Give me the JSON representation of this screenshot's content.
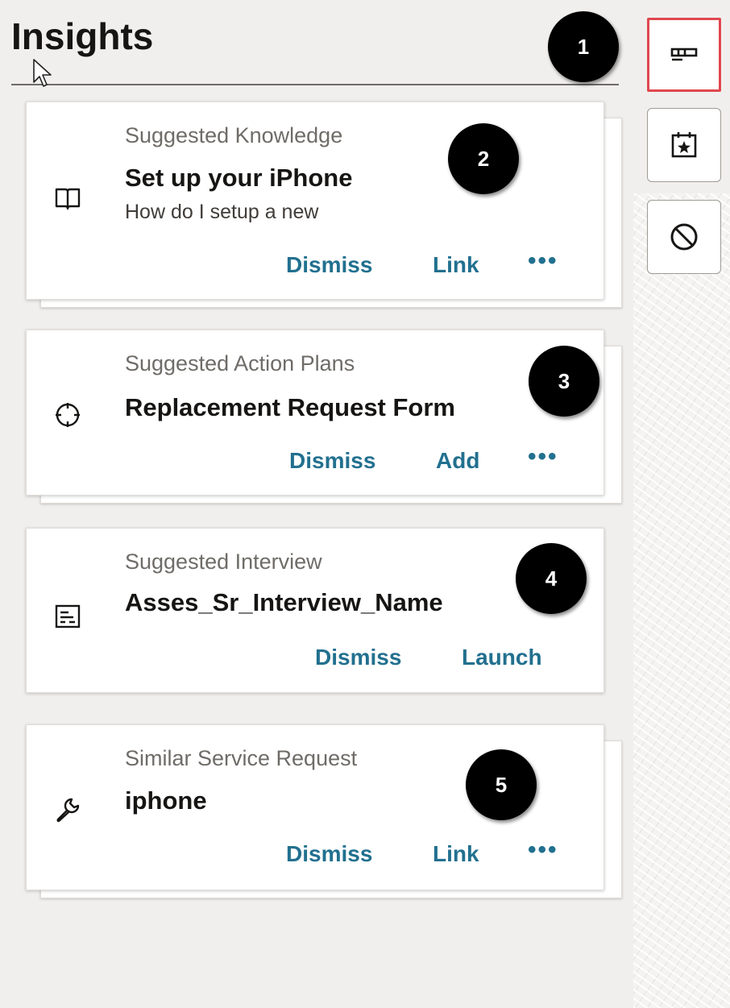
{
  "panel": {
    "title": "Insights"
  },
  "cards": [
    {
      "kicker": "Suggested Knowledge",
      "title": "Set up your iPhone",
      "description": "How do I setup a new",
      "icon": "book-icon",
      "actions": [
        "Dismiss",
        "Link"
      ],
      "has_more": true,
      "badge": "2"
    },
    {
      "kicker": "Suggested Action Plans",
      "title": "Replacement Request Form",
      "icon": "crosshair-icon",
      "actions": [
        "Dismiss",
        "Add"
      ],
      "has_more": true,
      "badge": "3"
    },
    {
      "kicker": "Suggested Interview",
      "title": "Asses_Sr_Interview_Name",
      "icon": "form-icon",
      "actions": [
        "Dismiss",
        "Launch"
      ],
      "has_more": false,
      "badge": "4"
    },
    {
      "kicker": "Similar Service Request",
      "title": "iphone",
      "icon": "wrench-icon",
      "actions": [
        "Dismiss",
        "Link"
      ],
      "has_more": true,
      "badge": "5"
    }
  ],
  "more_glyph": "•••",
  "callout_1": "1",
  "rail": {
    "buttons": [
      {
        "icon": "insights-icon",
        "active": true
      },
      {
        "icon": "calendar-star-icon",
        "active": false
      },
      {
        "icon": "block-icon",
        "active": false
      }
    ]
  },
  "colors": {
    "link": "#22708f",
    "highlight": "#e0474f",
    "badge": "#000000"
  }
}
